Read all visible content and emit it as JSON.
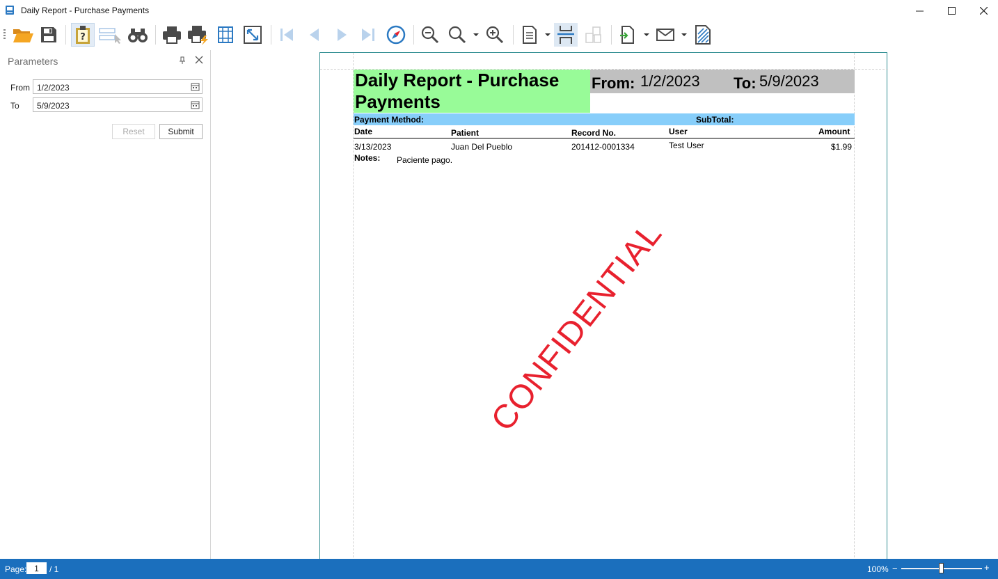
{
  "window": {
    "title": "Daily Report - Purchase Payments"
  },
  "toolbar": {
    "buttons": [
      "open-icon",
      "save-icon",
      "document-map-icon",
      "editing-fields-icon",
      "find-icon",
      "print-icon",
      "quick-print-icon",
      "page-setup-icon",
      "scale-icon",
      "first-page-icon",
      "previous-page-icon",
      "next-page-icon",
      "last-page-icon",
      "navigate-icon",
      "zoom-out-icon",
      "zoom-icon",
      "zoom-in-icon",
      "multiple-pages-icon",
      "continuous-scrolling-icon",
      "display-mode-icon",
      "export-icon",
      "send-email-icon",
      "watermark-icon"
    ]
  },
  "parameters": {
    "title": "Parameters",
    "from_label": "From",
    "from_value": "1/2/2023",
    "to_label": "To",
    "to_value": "5/9/2023",
    "reset_label": "Reset",
    "submit_label": "Submit"
  },
  "report": {
    "title": "Daily Report - Purchase Payments",
    "from_label": "From:",
    "from_value": "1/2/2023",
    "to_label": "To:",
    "to_value": "5/9/2023",
    "payment_method_label": "Payment Method:",
    "subtotal_label": "SubTotal:",
    "columns": [
      "Date",
      "Patient",
      "Record No.",
      "User",
      "Amount"
    ],
    "rows": [
      {
        "date": "3/13/2023",
        "patient": "Juan Del Pueblo",
        "record_no": "201412-0001334",
        "user": "Test User",
        "amount": "$1.99"
      }
    ],
    "notes_label": "Notes:",
    "notes_value": "Paciente pago.",
    "watermark": "CONFIDENTIAL",
    "colors": {
      "title_bg": "#98fb98",
      "range_bg": "#c0c0c0",
      "band_bg": "#87cefa",
      "watermark": "#e8212e"
    }
  },
  "status": {
    "page_label": "Page:",
    "page_value": "1",
    "page_total": "/ 1",
    "zoom": "100%",
    "zoom_minus": "−",
    "zoom_plus": "+"
  }
}
